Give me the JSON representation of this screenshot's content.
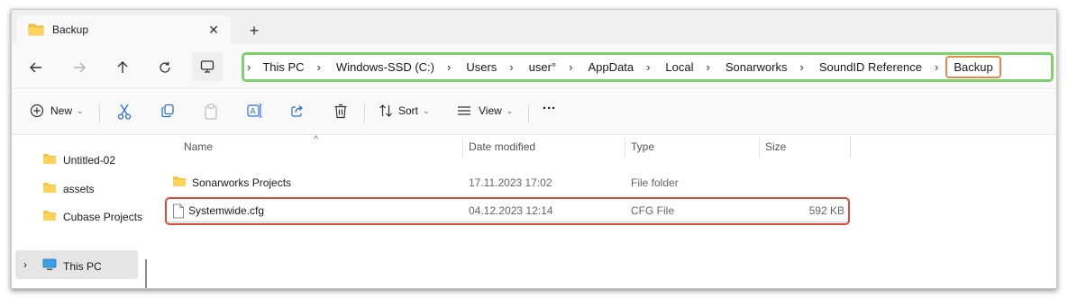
{
  "tab": {
    "title": "Backup",
    "close_glyph": "✕",
    "new_tab_glyph": "+"
  },
  "nav": {
    "back_icon": "arrow-left-icon",
    "forward_icon": "arrow-right-icon",
    "up_icon": "arrow-up-icon",
    "refresh_icon": "refresh-icon",
    "pc_icon": "monitor-icon"
  },
  "breadcrumb": {
    "items": [
      "This PC",
      "Windows-SSD (C:)",
      "Users",
      "user°",
      "AppData",
      "Local",
      "Sonarworks",
      "SoundID Reference",
      "Backup"
    ],
    "separator": "›"
  },
  "toolbar": {
    "new_label": "New",
    "sort_label": "Sort",
    "view_label": "View",
    "more_label": "···"
  },
  "sidebar": {
    "items": [
      {
        "label": "Untitled-02"
      },
      {
        "label": "assets"
      },
      {
        "label": "Cubase Projects"
      }
    ],
    "this_pc": "This PC",
    "expand_glyph": "›"
  },
  "filelist": {
    "columns": {
      "name": "Name",
      "date": "Date modified",
      "type": "Type",
      "size": "Size"
    },
    "sort_glyph": "^",
    "rows": [
      {
        "name": "Sonarworks Projects",
        "date": "17.11.2023 17:02",
        "type": "File folder",
        "size": ""
      },
      {
        "name": "Systemwide.cfg",
        "date": "04.12.2023 12:14",
        "type": "CFG File",
        "size": "592 KB"
      }
    ]
  },
  "colors": {
    "address_highlight": "#7ed26a",
    "current_crumb_highlight": "#e8884e",
    "selected_file_highlight": "#e04a3a",
    "folder_yellow": "#f5c542"
  }
}
